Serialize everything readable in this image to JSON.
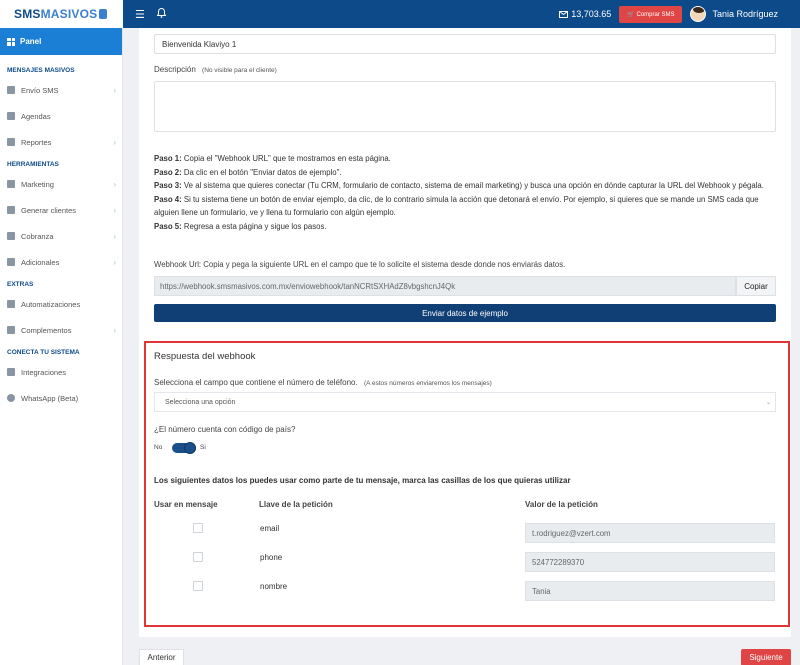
{
  "header": {
    "logo_sms": "SMS",
    "logo_masivos": "MASIVOS",
    "balance": "13,703.65",
    "buy_label": "Comprar SMS",
    "user_name": "Tania Rodríguez"
  },
  "sidebar": {
    "panel_label": "Panel",
    "sections": {
      "mensajes": "MENSAJES MASIVOS",
      "herramientas": "HERRAMIENTAS",
      "extras": "EXTRAS",
      "conecta": "CONECTA TU SISTEMA"
    },
    "items": {
      "envio": "Envío SMS",
      "agendas": "Agendas",
      "reportes": "Reportes",
      "marketing": "Marketing",
      "generar": "Generar clientes",
      "cobranza": "Cobranza",
      "adicionales": "Adicionales",
      "automatizaciones": "Automatizaciones",
      "complementos": "Complementos",
      "integraciones": "Integraciones",
      "whatsapp": "WhatsApp (Beta)"
    }
  },
  "form": {
    "name_value": "Bienvenida Klaviyo 1",
    "description_label": "Descripción",
    "description_note": "(No visible para el cliente)",
    "description_value": "",
    "steps": [
      {
        "label": "Paso 1:",
        "text": " Copia el \"Webhook URL\" que te mostramos en esta página."
      },
      {
        "label": "Paso 2:",
        "text": " Da clic en el botón \"Enviar datos de ejemplo\"."
      },
      {
        "label": "Paso 3:",
        "text": " Ve al sistema que quieres conectar (Tu CRM, formulario de contacto, sistema de email marketing) y busca una opción en dónde capturar la URL del Webhook y pégala."
      },
      {
        "label": "Paso 4:",
        "text": " Si tu sistema tiene un botón de enviar ejemplo, da clic, de lo contrario simula la acción que detonará el envío. Por ejemplo, si quieres que se mande un SMS cada que alguien llene un formulario, ve y llena tu formulario con algún ejemplo."
      },
      {
        "label": "Paso 5:",
        "text": " Regresa a esta página y sigue los pasos."
      }
    ],
    "webhook_label": "Webhook Url: Copia y pega la siguiente URL en el campo que te lo solicite el sistema desde donde nos enviarás datos.",
    "webhook_url": "https://webhook.smsmasivos.com.mx/enviowebhook/tanNCRtSXHAdZ8vbgshcnJ4Qk",
    "copy_label": "Copiar",
    "send_label": "Enviar datos de ejemplo"
  },
  "response": {
    "title": "Respuesta del webhook",
    "phone_field_label": "Selecciona el campo que contiene el número de teléfono.",
    "phone_field_note": "(A estos números enviaremos los mensajes)",
    "select_placeholder": "Selecciona una opción",
    "country_code_label": "¿El número cuenta con código de país?",
    "toggle_no": "No",
    "toggle_yes": "Si",
    "toggle_on": true,
    "data_info": "Los siguientes datos los puedes usar como parte de tu mensaje, marca las casillas de los que quieras utilizar",
    "col_use": "Usar en mensaje",
    "col_key": "Llave de la petición",
    "col_value": "Valor de la petición",
    "rows": [
      {
        "key": "email",
        "value": "t.rodriguez@vzert.com",
        "checked": false
      },
      {
        "key": "phone",
        "value": "524772289370",
        "checked": false
      },
      {
        "key": "nombre",
        "value": "Tania",
        "checked": false
      }
    ]
  },
  "footer": {
    "prev_label": "Anterior",
    "next_label": "Siguiente"
  }
}
